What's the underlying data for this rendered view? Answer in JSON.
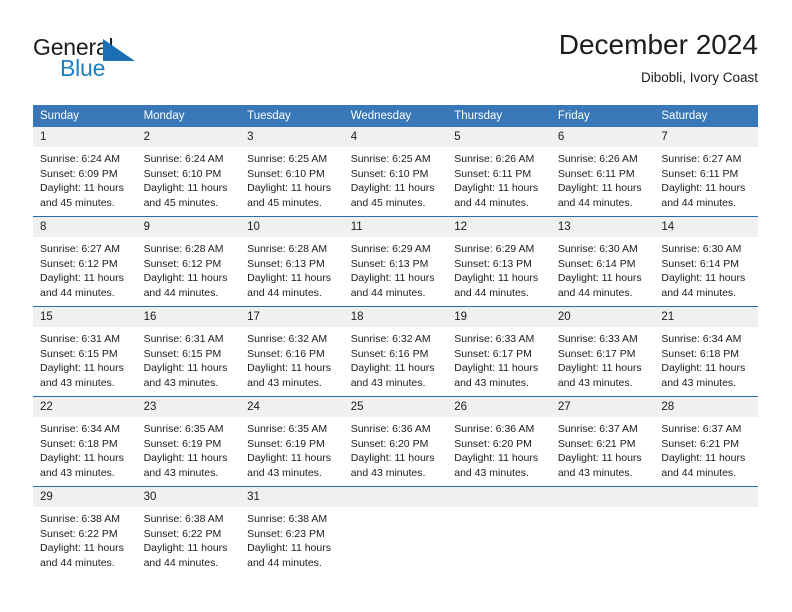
{
  "brand": {
    "name_part1": "General",
    "name_part2": "Blue",
    "accent_color": "#1a7fc1",
    "logo_mark_icon": "triangle-flag-icon"
  },
  "header": {
    "title": "December 2024",
    "subtitle": "Dibobli, Ivory Coast"
  },
  "theme": {
    "header_row_color": "#3877b8",
    "row_divider_color": "#2b6cab",
    "daynum_band_color": "#f0f0f0",
    "text_color": "#1c1c1c"
  },
  "calendar": {
    "weekday_headers": [
      "Sunday",
      "Monday",
      "Tuesday",
      "Wednesday",
      "Thursday",
      "Friday",
      "Saturday"
    ],
    "weeks": [
      [
        {
          "day": "1",
          "sunrise": "Sunrise: 6:24 AM",
          "sunset": "Sunset: 6:09 PM",
          "daylight": "Daylight: 11 hours and 45 minutes."
        },
        {
          "day": "2",
          "sunrise": "Sunrise: 6:24 AM",
          "sunset": "Sunset: 6:10 PM",
          "daylight": "Daylight: 11 hours and 45 minutes."
        },
        {
          "day": "3",
          "sunrise": "Sunrise: 6:25 AM",
          "sunset": "Sunset: 6:10 PM",
          "daylight": "Daylight: 11 hours and 45 minutes."
        },
        {
          "day": "4",
          "sunrise": "Sunrise: 6:25 AM",
          "sunset": "Sunset: 6:10 PM",
          "daylight": "Daylight: 11 hours and 45 minutes."
        },
        {
          "day": "5",
          "sunrise": "Sunrise: 6:26 AM",
          "sunset": "Sunset: 6:11 PM",
          "daylight": "Daylight: 11 hours and 44 minutes."
        },
        {
          "day": "6",
          "sunrise": "Sunrise: 6:26 AM",
          "sunset": "Sunset: 6:11 PM",
          "daylight": "Daylight: 11 hours and 44 minutes."
        },
        {
          "day": "7",
          "sunrise": "Sunrise: 6:27 AM",
          "sunset": "Sunset: 6:11 PM",
          "daylight": "Daylight: 11 hours and 44 minutes."
        }
      ],
      [
        {
          "day": "8",
          "sunrise": "Sunrise: 6:27 AM",
          "sunset": "Sunset: 6:12 PM",
          "daylight": "Daylight: 11 hours and 44 minutes."
        },
        {
          "day": "9",
          "sunrise": "Sunrise: 6:28 AM",
          "sunset": "Sunset: 6:12 PM",
          "daylight": "Daylight: 11 hours and 44 minutes."
        },
        {
          "day": "10",
          "sunrise": "Sunrise: 6:28 AM",
          "sunset": "Sunset: 6:13 PM",
          "daylight": "Daylight: 11 hours and 44 minutes."
        },
        {
          "day": "11",
          "sunrise": "Sunrise: 6:29 AM",
          "sunset": "Sunset: 6:13 PM",
          "daylight": "Daylight: 11 hours and 44 minutes."
        },
        {
          "day": "12",
          "sunrise": "Sunrise: 6:29 AM",
          "sunset": "Sunset: 6:13 PM",
          "daylight": "Daylight: 11 hours and 44 minutes."
        },
        {
          "day": "13",
          "sunrise": "Sunrise: 6:30 AM",
          "sunset": "Sunset: 6:14 PM",
          "daylight": "Daylight: 11 hours and 44 minutes."
        },
        {
          "day": "14",
          "sunrise": "Sunrise: 6:30 AM",
          "sunset": "Sunset: 6:14 PM",
          "daylight": "Daylight: 11 hours and 44 minutes."
        }
      ],
      [
        {
          "day": "15",
          "sunrise": "Sunrise: 6:31 AM",
          "sunset": "Sunset: 6:15 PM",
          "daylight": "Daylight: 11 hours and 43 minutes."
        },
        {
          "day": "16",
          "sunrise": "Sunrise: 6:31 AM",
          "sunset": "Sunset: 6:15 PM",
          "daylight": "Daylight: 11 hours and 43 minutes."
        },
        {
          "day": "17",
          "sunrise": "Sunrise: 6:32 AM",
          "sunset": "Sunset: 6:16 PM",
          "daylight": "Daylight: 11 hours and 43 minutes."
        },
        {
          "day": "18",
          "sunrise": "Sunrise: 6:32 AM",
          "sunset": "Sunset: 6:16 PM",
          "daylight": "Daylight: 11 hours and 43 minutes."
        },
        {
          "day": "19",
          "sunrise": "Sunrise: 6:33 AM",
          "sunset": "Sunset: 6:17 PM",
          "daylight": "Daylight: 11 hours and 43 minutes."
        },
        {
          "day": "20",
          "sunrise": "Sunrise: 6:33 AM",
          "sunset": "Sunset: 6:17 PM",
          "daylight": "Daylight: 11 hours and 43 minutes."
        },
        {
          "day": "21",
          "sunrise": "Sunrise: 6:34 AM",
          "sunset": "Sunset: 6:18 PM",
          "daylight": "Daylight: 11 hours and 43 minutes."
        }
      ],
      [
        {
          "day": "22",
          "sunrise": "Sunrise: 6:34 AM",
          "sunset": "Sunset: 6:18 PM",
          "daylight": "Daylight: 11 hours and 43 minutes."
        },
        {
          "day": "23",
          "sunrise": "Sunrise: 6:35 AM",
          "sunset": "Sunset: 6:19 PM",
          "daylight": "Daylight: 11 hours and 43 minutes."
        },
        {
          "day": "24",
          "sunrise": "Sunrise: 6:35 AM",
          "sunset": "Sunset: 6:19 PM",
          "daylight": "Daylight: 11 hours and 43 minutes."
        },
        {
          "day": "25",
          "sunrise": "Sunrise: 6:36 AM",
          "sunset": "Sunset: 6:20 PM",
          "daylight": "Daylight: 11 hours and 43 minutes."
        },
        {
          "day": "26",
          "sunrise": "Sunrise: 6:36 AM",
          "sunset": "Sunset: 6:20 PM",
          "daylight": "Daylight: 11 hours and 43 minutes."
        },
        {
          "day": "27",
          "sunrise": "Sunrise: 6:37 AM",
          "sunset": "Sunset: 6:21 PM",
          "daylight": "Daylight: 11 hours and 43 minutes."
        },
        {
          "day": "28",
          "sunrise": "Sunrise: 6:37 AM",
          "sunset": "Sunset: 6:21 PM",
          "daylight": "Daylight: 11 hours and 44 minutes."
        }
      ],
      [
        {
          "day": "29",
          "sunrise": "Sunrise: 6:38 AM",
          "sunset": "Sunset: 6:22 PM",
          "daylight": "Daylight: 11 hours and 44 minutes."
        },
        {
          "day": "30",
          "sunrise": "Sunrise: 6:38 AM",
          "sunset": "Sunset: 6:22 PM",
          "daylight": "Daylight: 11 hours and 44 minutes."
        },
        {
          "day": "31",
          "sunrise": "Sunrise: 6:38 AM",
          "sunset": "Sunset: 6:23 PM",
          "daylight": "Daylight: 11 hours and 44 minutes."
        },
        {
          "day": "",
          "sunrise": "",
          "sunset": "",
          "daylight": ""
        },
        {
          "day": "",
          "sunrise": "",
          "sunset": "",
          "daylight": ""
        },
        {
          "day": "",
          "sunrise": "",
          "sunset": "",
          "daylight": ""
        },
        {
          "day": "",
          "sunrise": "",
          "sunset": "",
          "daylight": ""
        }
      ]
    ]
  }
}
